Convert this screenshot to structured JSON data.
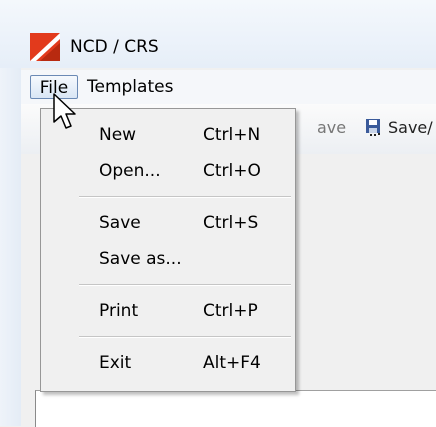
{
  "window": {
    "title": "NCD / CRS",
    "icon": "ncd-app-icon",
    "brand_color": "#e23a1c"
  },
  "menubar": {
    "items": [
      {
        "label": "File",
        "active": true
      },
      {
        "label": "Templates",
        "active": false
      }
    ]
  },
  "toolbar": {
    "save_label": "ave",
    "saveas_label": "Save/",
    "saveas_icon": "floppy-disk-icon"
  },
  "file_menu": {
    "items": [
      {
        "label": "New",
        "shortcut": "Ctrl+N"
      },
      {
        "label": "Open...",
        "shortcut": "Ctrl+O"
      },
      {
        "label": "Save",
        "shortcut": "Ctrl+S"
      },
      {
        "label": "Save as...",
        "shortcut": ""
      },
      {
        "label": "Print",
        "shortcut": "Ctrl+P"
      },
      {
        "label": "Exit",
        "shortcut": "Alt+F4"
      }
    ]
  }
}
